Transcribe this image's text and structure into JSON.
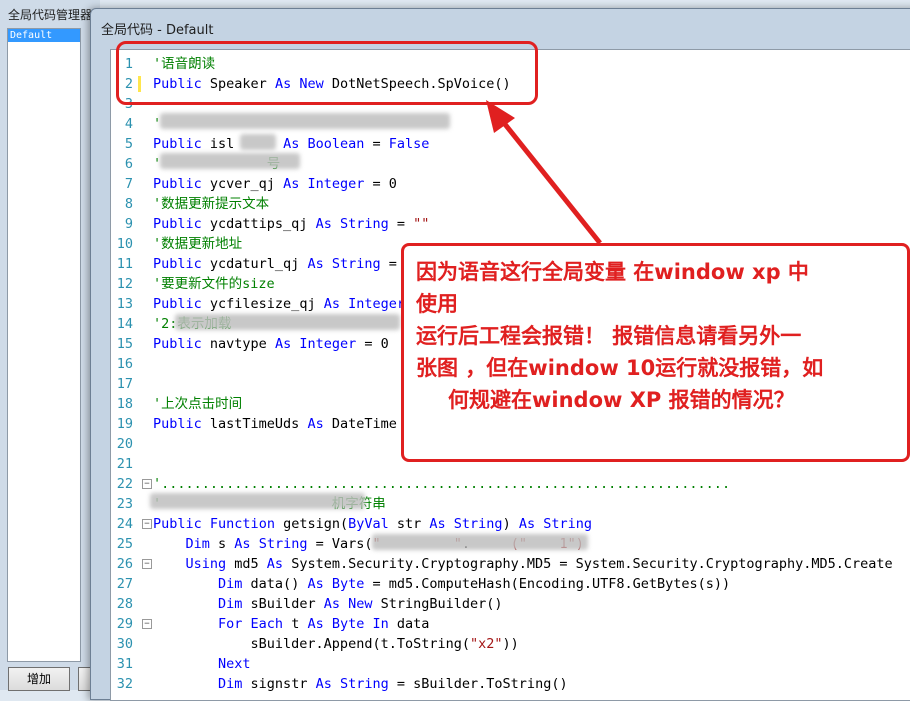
{
  "background_window": {
    "title": "全局代码管理器",
    "list_items": [
      "Default"
    ],
    "add_button": "增加"
  },
  "main_window": {
    "title": "全局代码 - Default"
  },
  "code_lines": [
    {
      "n": "1",
      "tokens": [
        [
          "cm",
          "'语音朗读"
        ]
      ]
    },
    {
      "n": "2",
      "tokens": [
        [
          "kw",
          "Public"
        ],
        [
          "",
          " Speaker "
        ],
        [
          "kw",
          "As"
        ],
        [
          "",
          " "
        ],
        [
          "kw",
          "New"
        ],
        [
          "",
          " DotNetSpeech.SpVoice()"
        ]
      ]
    },
    {
      "n": "3",
      "tokens": []
    },
    {
      "n": "4",
      "tokens": [
        [
          "cm",
          "'"
        ]
      ]
    },
    {
      "n": "5",
      "tokens": [
        [
          "kw",
          "Public"
        ],
        [
          "",
          " isl      "
        ],
        [
          "kw",
          "As"
        ],
        [
          "",
          " "
        ],
        [
          "kw",
          "Boolean"
        ],
        [
          "",
          " = "
        ],
        [
          "kw",
          "False"
        ]
      ]
    },
    {
      "n": "6",
      "tokens": [
        [
          "cm",
          "'             号"
        ]
      ]
    },
    {
      "n": "7",
      "tokens": [
        [
          "kw",
          "Public"
        ],
        [
          "",
          " ycver_qj "
        ],
        [
          "kw",
          "As"
        ],
        [
          "",
          " "
        ],
        [
          "kw",
          "Integer"
        ],
        [
          "",
          " = 0"
        ]
      ]
    },
    {
      "n": "8",
      "tokens": [
        [
          "cm",
          "'数据更新提示文本"
        ]
      ]
    },
    {
      "n": "9",
      "tokens": [
        [
          "kw",
          "Public"
        ],
        [
          "",
          " ycdattips_qj "
        ],
        [
          "kw",
          "As"
        ],
        [
          "",
          " "
        ],
        [
          "kw",
          "String"
        ],
        [
          "",
          " = "
        ],
        [
          "str",
          "\"\""
        ]
      ]
    },
    {
      "n": "10",
      "tokens": [
        [
          "cm",
          "'数据更新地址"
        ]
      ]
    },
    {
      "n": "11",
      "tokens": [
        [
          "kw",
          "Public"
        ],
        [
          "",
          " ycdaturl_qj "
        ],
        [
          "kw",
          "As"
        ],
        [
          "",
          " "
        ],
        [
          "kw",
          "String"
        ],
        [
          "",
          " = "
        ]
      ]
    },
    {
      "n": "12",
      "tokens": [
        [
          "cm",
          "'要更新文件的size"
        ]
      ]
    },
    {
      "n": "13",
      "tokens": [
        [
          "kw",
          "Public"
        ],
        [
          "",
          " ycfilesize_qj "
        ],
        [
          "kw",
          "As"
        ],
        [
          "",
          " "
        ],
        [
          "kw",
          "Integer"
        ]
      ]
    },
    {
      "n": "14",
      "tokens": [
        [
          "cm",
          "'2:表示加载 "
        ]
      ]
    },
    {
      "n": "15",
      "tokens": [
        [
          "kw",
          "Public"
        ],
        [
          "",
          " navtype "
        ],
        [
          "kw",
          "As"
        ],
        [
          "",
          " "
        ],
        [
          "kw",
          "Integer"
        ],
        [
          "",
          " = 0"
        ]
      ]
    },
    {
      "n": "16",
      "tokens": []
    },
    {
      "n": "17",
      "tokens": []
    },
    {
      "n": "18",
      "tokens": [
        [
          "cm",
          "'上次点击时间"
        ]
      ]
    },
    {
      "n": "19",
      "tokens": [
        [
          "kw",
          "Public"
        ],
        [
          "",
          " lastTimeUds "
        ],
        [
          "kw",
          "As"
        ],
        [
          "",
          " DateTime"
        ]
      ]
    },
    {
      "n": "20",
      "tokens": []
    },
    {
      "n": "21",
      "tokens": []
    },
    {
      "n": "22",
      "tokens": [
        [
          "cm",
          "'......................................................................"
        ]
      ]
    },
    {
      "n": "23",
      "tokens": [
        [
          "cm",
          "'                     机字符串"
        ]
      ]
    },
    {
      "n": "24",
      "tokens": [
        [
          "kw",
          "Public"
        ],
        [
          "",
          " "
        ],
        [
          "kw",
          "Function"
        ],
        [
          "",
          " getsign("
        ],
        [
          "kw",
          "ByVal"
        ],
        [
          "",
          " str "
        ],
        [
          "kw",
          "As"
        ],
        [
          "",
          " "
        ],
        [
          "kw",
          "String"
        ],
        [
          "",
          ") "
        ],
        [
          "kw",
          "As"
        ],
        [
          "",
          " "
        ],
        [
          "kw",
          "String"
        ]
      ]
    },
    {
      "n": "25",
      "tokens": [
        [
          "",
          "    "
        ],
        [
          "kw",
          "Dim"
        ],
        [
          "",
          " s "
        ],
        [
          "kw",
          "As"
        ],
        [
          "",
          " "
        ],
        [
          "kw",
          "String"
        ],
        [
          "",
          " = Vars("
        ],
        [
          "str",
          "\"         \""
        ],
        [
          "",
          ".     "
        ],
        [
          "str",
          "(\"    1\")"
        ]
      ]
    },
    {
      "n": "26",
      "tokens": [
        [
          "",
          "    "
        ],
        [
          "kw",
          "Using"
        ],
        [
          "",
          " md5 "
        ],
        [
          "kw",
          "As"
        ],
        [
          "",
          " System.Security.Cryptography.MD5 = System.Security.Cryptography.MD5.Create"
        ]
      ]
    },
    {
      "n": "27",
      "tokens": [
        [
          "",
          "        "
        ],
        [
          "kw",
          "Dim"
        ],
        [
          "",
          " data() "
        ],
        [
          "kw",
          "As"
        ],
        [
          "",
          " "
        ],
        [
          "kw",
          "Byte"
        ],
        [
          "",
          " = md5.ComputeHash(Encoding.UTF8.GetBytes(s))"
        ]
      ]
    },
    {
      "n": "28",
      "tokens": [
        [
          "",
          "        "
        ],
        [
          "kw",
          "Dim"
        ],
        [
          "",
          " sBuilder "
        ],
        [
          "kw",
          "As"
        ],
        [
          "",
          " "
        ],
        [
          "kw",
          "New"
        ],
        [
          "",
          " StringBuilder()"
        ]
      ]
    },
    {
      "n": "29",
      "tokens": [
        [
          "",
          "        "
        ],
        [
          "kw",
          "For Each"
        ],
        [
          "",
          " t "
        ],
        [
          "kw",
          "As"
        ],
        [
          "",
          " "
        ],
        [
          "kw",
          "Byte"
        ],
        [
          "",
          " "
        ],
        [
          "kw",
          "In"
        ],
        [
          "",
          " data"
        ]
      ]
    },
    {
      "n": "30",
      "tokens": [
        [
          "",
          "            sBuilder.Append(t.ToString("
        ],
        [
          "str",
          "\"x2\""
        ],
        [
          "",
          "))"
        ]
      ]
    },
    {
      "n": "31",
      "tokens": [
        [
          "",
          "        "
        ],
        [
          "kw",
          "Next"
        ]
      ]
    },
    {
      "n": "32",
      "tokens": [
        [
          "",
          "        "
        ],
        [
          "kw",
          "Dim"
        ],
        [
          "",
          " signstr "
        ],
        [
          "kw",
          "As"
        ],
        [
          "",
          " "
        ],
        [
          "kw",
          "String"
        ],
        [
          "",
          " = sBuilder.ToString()"
        ]
      ]
    }
  ],
  "callout": {
    "lines": [
      "因为语音这行全局变量  在window xp 中",
      "使用",
      " 运行后工程会报错！ 报错信息请看另外一",
      "张图 ，但在window 10运行就没报错，如",
      "何规避在window XP 报错的情况？"
    ]
  },
  "colors": {
    "keyword": "#0000ff",
    "comment": "#008000",
    "string": "#a31515",
    "line_number": "#2b91af",
    "annotation_red": "#e02020"
  }
}
